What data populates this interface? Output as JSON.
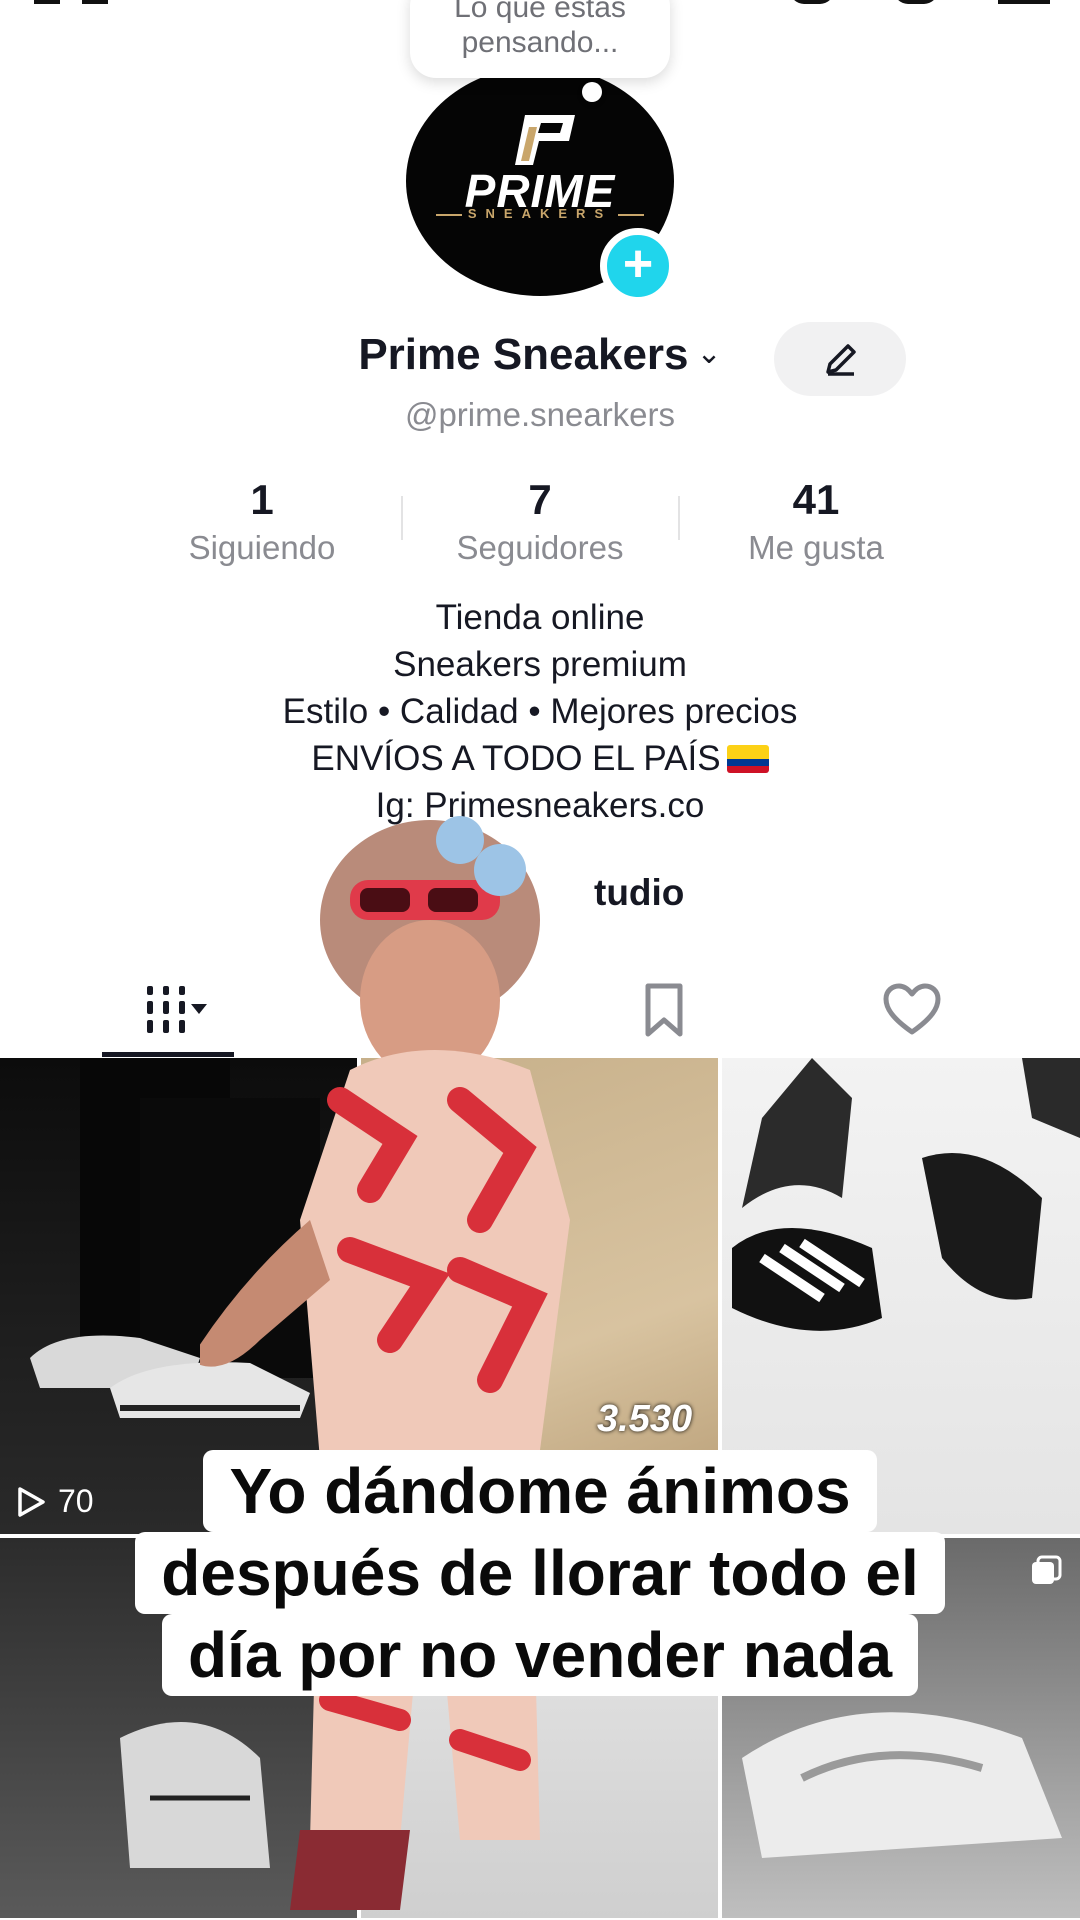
{
  "bubble": {
    "text": "Lo que estás pensando..."
  },
  "profile": {
    "logo_word": "PRIME",
    "logo_sub": "SNEAKERS",
    "display_name": "Prime Sneakers",
    "handle": "@prime.snearkers"
  },
  "stats": [
    {
      "value": "1",
      "label": "Siguiendo"
    },
    {
      "value": "7",
      "label": "Seguidores"
    },
    {
      "value": "41",
      "label": "Me gusta"
    }
  ],
  "bio": {
    "line1": "Tienda online",
    "line2": "Sneakers premium",
    "line3": "Estilo • Calidad • Mejores precios",
    "line4": "ENVÍOS A TODO EL PAÍS",
    "line5": "Ig: Primesneakers.co"
  },
  "studio": {
    "label": "tudio"
  },
  "tabs": [
    {
      "name": "videos",
      "icon": "grid-icon"
    },
    {
      "name": "private",
      "icon": "lock-icon"
    },
    {
      "name": "saved",
      "icon": "bookmark-icon"
    },
    {
      "name": "liked",
      "icon": "heart-icon"
    }
  ],
  "grid": {
    "cell1_views": "70",
    "cell2_price": "3.530"
  },
  "caption": {
    "line1": "Yo dándome ánimos",
    "line2": "después de llorar todo el",
    "line3": "día por no vender nada"
  },
  "colors": {
    "accent_cyan": "#20d5ec",
    "accent_pink": "#fe2c55",
    "text": "#161823",
    "muted": "#8a8b91"
  }
}
